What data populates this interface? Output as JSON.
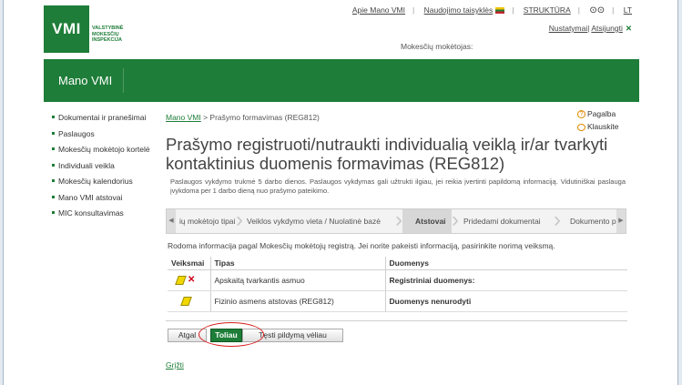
{
  "header": {
    "logo_text": "VMI",
    "logo_subtext": [
      "VALSTYBINĖ",
      "MOKESČIŲ",
      "INSPEKCIJA"
    ],
    "top_links": {
      "about": "Apie Mano VMI",
      "rules": "Naudojimo taisyklės",
      "structure": "STRUKTŪRA",
      "lang": "LT"
    },
    "settings": "Nustatymai",
    "logout": "Atsijungti",
    "payer_label": "Mokesčių mokėtojas:"
  },
  "banner": {
    "title": "Mano VMI"
  },
  "sidebar": {
    "items": [
      {
        "label": "Dokumentai ir pranešimai"
      },
      {
        "label": "Paslaugos"
      },
      {
        "label": "Mokesčių mokėtojo kortelė"
      },
      {
        "label": "Individuali veikla"
      },
      {
        "label": "Mokesčių kalendorius"
      },
      {
        "label": "Mano VMI atstovai"
      },
      {
        "label": "MIC konsultavimas"
      }
    ]
  },
  "breadcrumb": {
    "home": "Mano VMI",
    "current": " > Prašymo formavimas (REG812)"
  },
  "help": {
    "help": "Pagalba",
    "ask": "Klauskite"
  },
  "page": {
    "title": "Prašymo registruoti/nutraukti individualią veiklą ir/ar tvarkyti kontaktinius duomenis formavimas (REG812)",
    "description": "Paslaugos vykdymo trukmė 5 darbo dienos. Paslaugos vykdymas gali užtrukti ilgiau, jei reikia įvertinti papildomą informaciją. Vidutiniškai paslauga įvykdoma per 1 darbo dieną nuo prašymo pateikimo."
  },
  "steps": [
    {
      "label": "ių mokėtojo tipai"
    },
    {
      "label": "Veiklos vykdymo vieta / Nuolatinė bazė"
    },
    {
      "label": "Atstovai"
    },
    {
      "label": "Pridedami dokumentai"
    },
    {
      "label": "Dokumento p"
    }
  ],
  "info_text": "Rodoma informacija pagal Mokesčių mokėtojų registrą. Jei norite pakeisti informaciją, pasirinkite norimą veiksmą.",
  "table": {
    "headers": [
      "Veiksmai",
      "Tipas",
      "Duomenys"
    ],
    "rows": [
      {
        "type": "Apskaitą tvarkantis asmuo",
        "data": "Registriniai duomenys:"
      },
      {
        "type": "Fizinio asmens atstovas (REG812)",
        "data": "Duomenys nenurodyti"
      }
    ]
  },
  "buttons": {
    "back": "Atgal",
    "next": "Toliau",
    "later": "Tęsti pildymą vėliau"
  },
  "return_link": "Grįžti",
  "colors": {
    "brand": "#1e7d38",
    "highlight": "#d81c1c"
  },
  "icons": [
    "glasses-icon",
    "flag-icon",
    "close-icon",
    "help-icon",
    "chat-icon",
    "edit-icon",
    "delete-icon"
  ]
}
